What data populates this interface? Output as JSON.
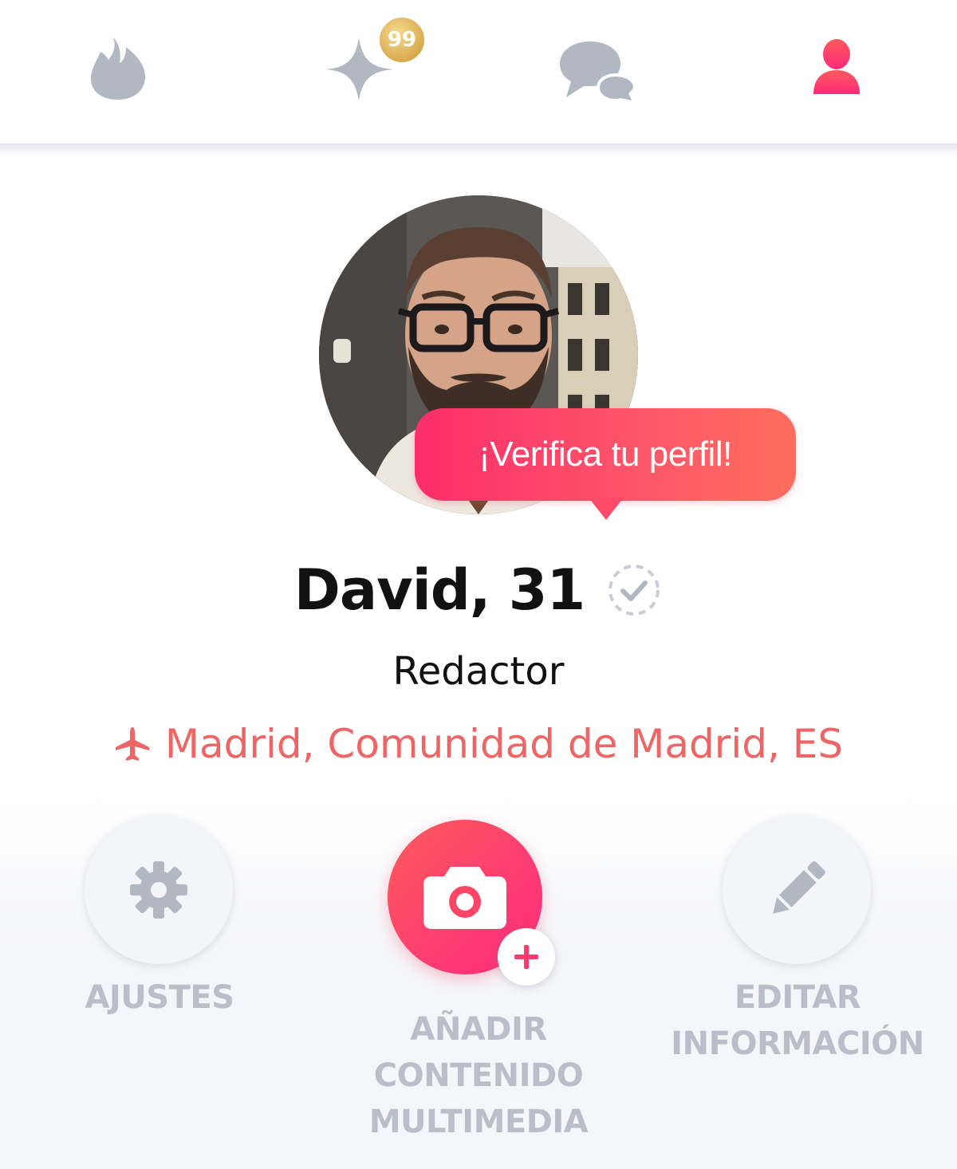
{
  "nav": {
    "tabs": [
      {
        "name": "flame-icon",
        "active": false
      },
      {
        "name": "sparkle-icon",
        "active": false,
        "badge": "99"
      },
      {
        "name": "chat-icon",
        "active": false
      },
      {
        "name": "profile-icon",
        "active": true
      }
    ],
    "badge_count": "99"
  },
  "profile": {
    "tooltip": "¡Verifica tu perfil!",
    "name_age": "David, 31",
    "job": "Redactor",
    "location": "Madrid, Comunidad de Madrid, ES"
  },
  "actions": {
    "settings_label": "AJUSTES",
    "media_label_line1": "AÑADIR",
    "media_label_line2": "CONTENIDO",
    "media_label_line3": "MULTIMEDIA",
    "edit_label_line1": "EDITAR",
    "edit_label_line2": "INFORMACIÓN"
  },
  "colors": {
    "accent": "#fd3c6e",
    "location_text": "#ee6565",
    "icon_inactive": "#b2b8c2",
    "label_gray": "#b9bec9",
    "badge_gold": "#d9ab4f"
  }
}
